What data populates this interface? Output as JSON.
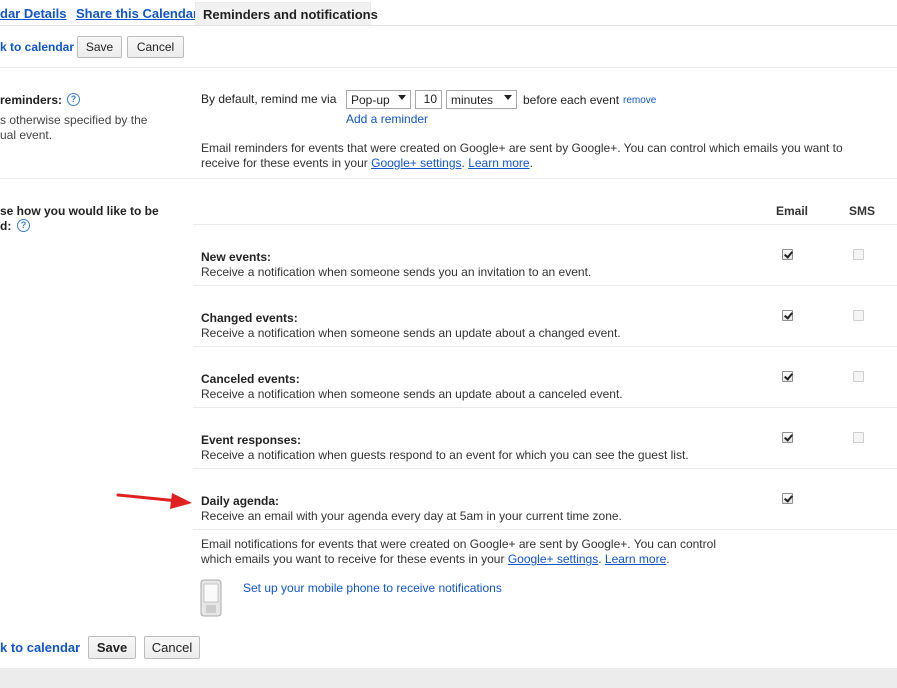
{
  "tabs": [
    {
      "label": "dar Details"
    },
    {
      "label": "Share this Calendar"
    },
    {
      "label": "Reminders and notifications"
    }
  ],
  "toolbar": {
    "back_link": "k to calendar",
    "save_label": "Save",
    "cancel_label": "Cancel"
  },
  "reminders": {
    "heading": "reminders:",
    "desc_line1": "s otherwise specified by the",
    "desc_line2": "ual event.",
    "default_prefix": "By default, remind me via",
    "method": "Pop-up",
    "amount": "10",
    "unit": "minutes",
    "suffix": "before each event",
    "remove_label": "remove",
    "add_label": "Add a reminder",
    "email_note_1": "Email reminders for events that were created on Google+ are sent by Google+. You can control which emails you want to",
    "email_note_2": "receive for these events in your",
    "gplus_link": "Google+ settings",
    "learn_more": "Learn more",
    "period": "."
  },
  "notifications": {
    "heading_line1": "se how you would like to be",
    "heading_line2": "d:",
    "col_email": "Email",
    "col_sms": "SMS",
    "rows": [
      {
        "title": "New events:",
        "desc": "Receive a notification when someone sends you an invitation to an event.",
        "email": true,
        "sms": false
      },
      {
        "title": "Changed events:",
        "desc": "Receive a notification when someone sends an update about a changed event.",
        "email": true,
        "sms": false
      },
      {
        "title": "Canceled events:",
        "desc": "Receive a notification when someone sends an update about a canceled event.",
        "email": true,
        "sms": false
      },
      {
        "title": "Event responses:",
        "desc": "Receive a notification when guests respond to an event for which you can see the guest list.",
        "email": true,
        "sms": false
      },
      {
        "title": "Daily agenda:",
        "desc": "Receive an email with your agenda every day at 5am in your current time zone.",
        "email": true
      }
    ],
    "note_1": "Email notifications for events that were created on Google+ are sent by Google+. You can control",
    "note_2": "which emails you want to receive for these events in your",
    "gplus_link": "Google+ settings",
    "learn_more": "Learn more",
    "period": ".",
    "mobile_link": "Set up your mobile phone to receive notifications"
  },
  "colors": {
    "link": "#1155cc",
    "arrow": "#e02020"
  }
}
